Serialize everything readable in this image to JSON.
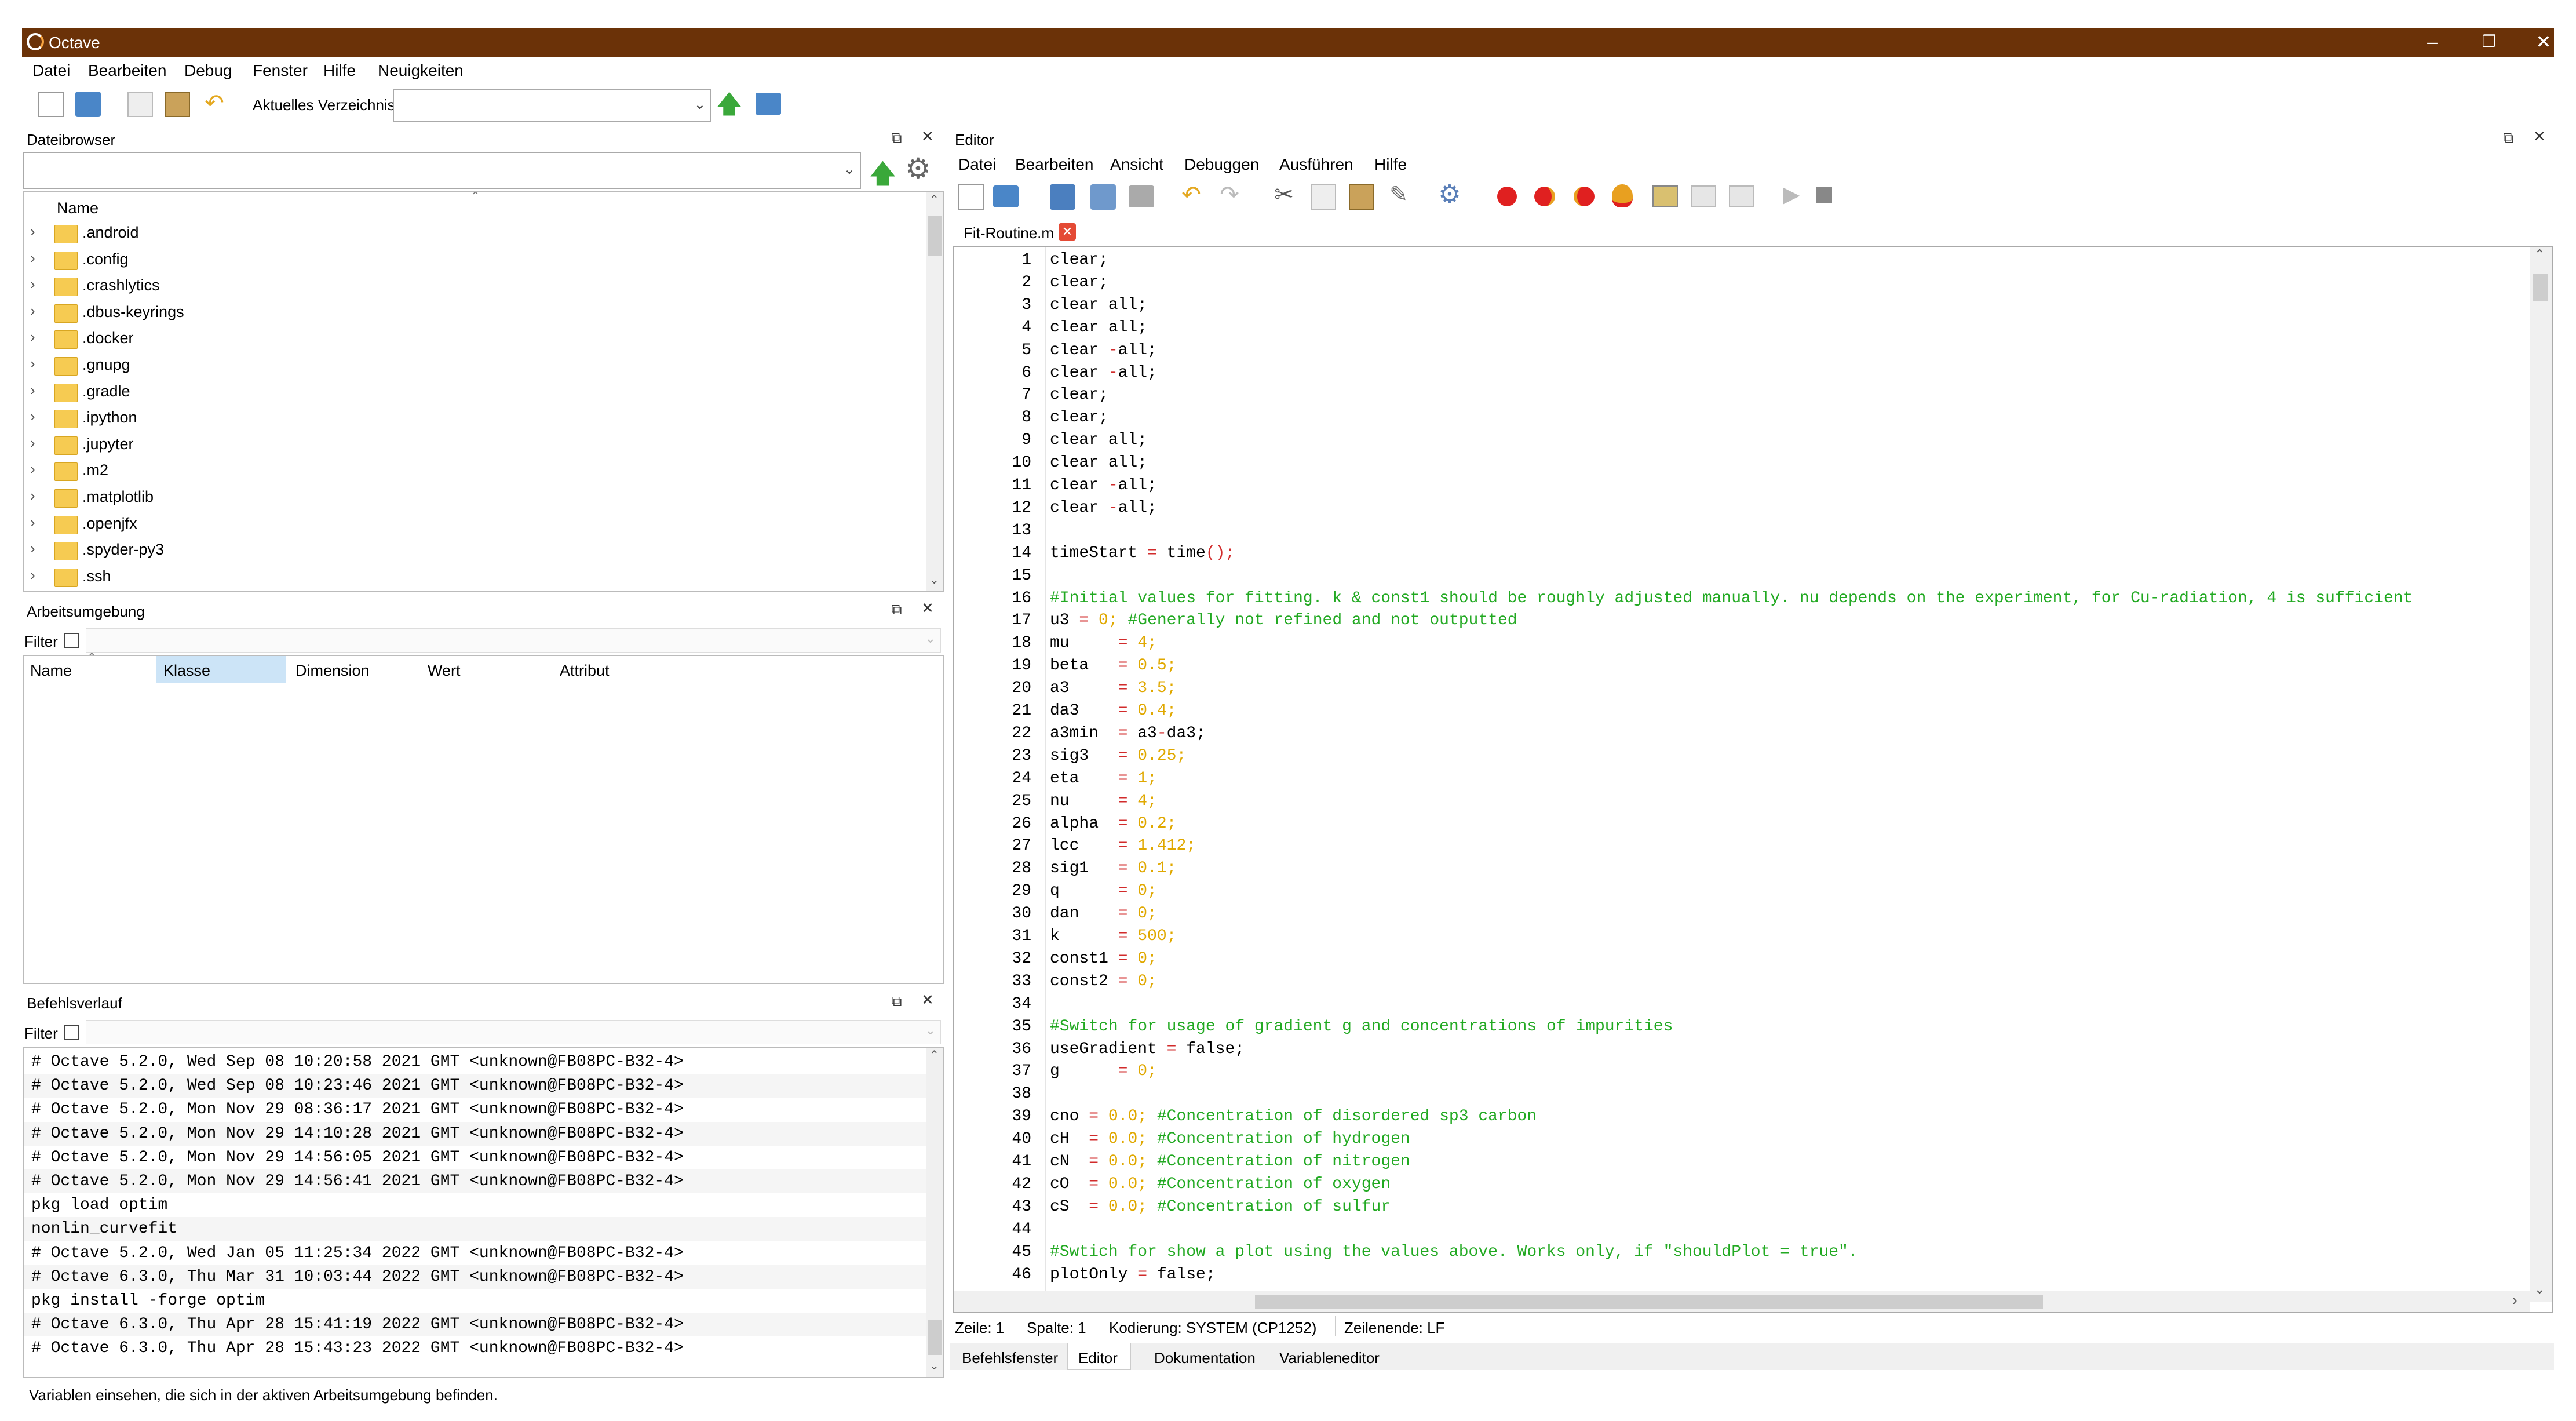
{
  "window": {
    "title": "Octave"
  },
  "main_menu": [
    "Datei",
    "Bearbeiten",
    "Debug",
    "Fenster",
    "Hilfe",
    "Neuigkeiten"
  ],
  "toolbar": {
    "current_dir_label": "Aktuelles Verzeichnis:",
    "current_dir_value": ""
  },
  "file_browser": {
    "title": "Dateibrowser",
    "column": "Name",
    "items": [
      ".android",
      ".config",
      ".crashlytics",
      ".dbus-keyrings",
      ".docker",
      ".gnupg",
      ".gradle",
      ".ipython",
      ".jupyter",
      ".m2",
      ".matplotlib",
      ".openjfx",
      ".spyder-py3",
      ".ssh"
    ]
  },
  "workspace": {
    "title": "Arbeitsumgebung",
    "filter_label": "Filter",
    "columns": [
      "Name",
      "Klasse",
      "Dimension",
      "Wert",
      "Attribut"
    ]
  },
  "history": {
    "title": "Befehlsverlauf",
    "filter_label": "Filter",
    "lines": [
      "# Octave 5.2.0, Wed Sep 08 10:20:58 2021 GMT <unknown@FB08PC-B32-4>",
      "# Octave 5.2.0, Wed Sep 08 10:23:46 2021 GMT <unknown@FB08PC-B32-4>",
      "# Octave 5.2.0, Mon Nov 29 08:36:17 2021 GMT <unknown@FB08PC-B32-4>",
      "# Octave 5.2.0, Mon Nov 29 14:10:28 2021 GMT <unknown@FB08PC-B32-4>",
      "# Octave 5.2.0, Mon Nov 29 14:56:05 2021 GMT <unknown@FB08PC-B32-4>",
      "# Octave 5.2.0, Mon Nov 29 14:56:41 2021 GMT <unknown@FB08PC-B32-4>",
      "pkg load optim",
      "nonlin_curvefit",
      "# Octave 5.2.0, Wed Jan 05 11:25:34 2022 GMT <unknown@FB08PC-B32-4>",
      "# Octave 6.3.0, Thu Mar 31 10:03:44 2022 GMT <unknown@FB08PC-B32-4>",
      "pkg install -forge optim",
      "# Octave 6.3.0, Thu Apr 28 15:41:19 2022 GMT <unknown@FB08PC-B32-4>",
      "# Octave 6.3.0, Thu Apr 28 15:43:23 2022 GMT <unknown@FB08PC-B32-4>"
    ]
  },
  "status_message": "Variablen einsehen, die sich in der aktiven Arbeitsumgebung befinden.",
  "editor": {
    "title": "Editor",
    "menu": [
      "Datei",
      "Bearbeiten",
      "Ansicht",
      "Debuggen",
      "Ausführen",
      "Hilfe"
    ],
    "file_tab": "Fit-Routine.m",
    "status": {
      "line": "Zeile: 1",
      "column": "Spalte: 1",
      "encoding": "Kodierung: SYSTEM (CP1252)",
      "eol": "Zeilenende: LF"
    },
    "colors": {
      "comment": "#22a922",
      "number": "#e0a800",
      "operator": "#d12b2b",
      "default": "#000000"
    },
    "lines": [
      [
        [
          "clear;",
          "d"
        ]
      ],
      [
        [
          "clear;",
          "d"
        ]
      ],
      [
        [
          "clear all;",
          "d"
        ]
      ],
      [
        [
          "clear all;",
          "d"
        ]
      ],
      [
        [
          "clear ",
          "d"
        ],
        [
          "-",
          "o"
        ],
        [
          "all;",
          "d"
        ]
      ],
      [
        [
          "clear ",
          "d"
        ],
        [
          "-",
          "o"
        ],
        [
          "all;",
          "d"
        ]
      ],
      [
        [
          "clear;",
          "d"
        ]
      ],
      [
        [
          "clear;",
          "d"
        ]
      ],
      [
        [
          "clear all;",
          "d"
        ]
      ],
      [
        [
          "clear all;",
          "d"
        ]
      ],
      [
        [
          "clear ",
          "d"
        ],
        [
          "-",
          "o"
        ],
        [
          "all;",
          "d"
        ]
      ],
      [
        [
          "clear ",
          "d"
        ],
        [
          "-",
          "o"
        ],
        [
          "all;",
          "d"
        ]
      ],
      [],
      [
        [
          "timeStart ",
          "d"
        ],
        [
          "=",
          "o"
        ],
        [
          " time",
          "d"
        ],
        [
          "();",
          "o"
        ],
        [
          "",
          "d"
        ]
      ],
      [],
      [
        [
          "#Initial values for fitting. k & const1 should be roughly adjusted manually. nu depends on the experiment, for Cu-radiation, 4 is sufficient",
          "c"
        ]
      ],
      [
        [
          "u3 ",
          "d"
        ],
        [
          "=",
          "o"
        ],
        [
          " 0;",
          "n"
        ],
        [
          " #Generally not refined and not outputted",
          "c"
        ]
      ],
      [
        [
          "mu     ",
          "d"
        ],
        [
          "=",
          "o"
        ],
        [
          " 4;",
          "n"
        ]
      ],
      [
        [
          "beta   ",
          "d"
        ],
        [
          "=",
          "o"
        ],
        [
          " 0.5;",
          "n"
        ]
      ],
      [
        [
          "a3     ",
          "d"
        ],
        [
          "=",
          "o"
        ],
        [
          " 3.5;",
          "n"
        ]
      ],
      [
        [
          "da3    ",
          "d"
        ],
        [
          "=",
          "o"
        ],
        [
          " 0.4;",
          "n"
        ]
      ],
      [
        [
          "a3min  ",
          "d"
        ],
        [
          "=",
          "o"
        ],
        [
          " a3",
          "d"
        ],
        [
          "-",
          "o"
        ],
        [
          "da3;",
          "d"
        ]
      ],
      [
        [
          "sig3   ",
          "d"
        ],
        [
          "=",
          "o"
        ],
        [
          " 0.25;",
          "n"
        ]
      ],
      [
        [
          "eta    ",
          "d"
        ],
        [
          "=",
          "o"
        ],
        [
          " 1;",
          "n"
        ]
      ],
      [
        [
          "nu     ",
          "d"
        ],
        [
          "=",
          "o"
        ],
        [
          " 4;",
          "n"
        ]
      ],
      [
        [
          "alpha  ",
          "d"
        ],
        [
          "=",
          "o"
        ],
        [
          " 0.2;",
          "n"
        ]
      ],
      [
        [
          "lcc    ",
          "d"
        ],
        [
          "=",
          "o"
        ],
        [
          " 1.412;",
          "n"
        ]
      ],
      [
        [
          "sig1   ",
          "d"
        ],
        [
          "=",
          "o"
        ],
        [
          " 0.1;",
          "n"
        ]
      ],
      [
        [
          "q      ",
          "d"
        ],
        [
          "=",
          "o"
        ],
        [
          " 0;",
          "n"
        ]
      ],
      [
        [
          "dan    ",
          "d"
        ],
        [
          "=",
          "o"
        ],
        [
          " 0;",
          "n"
        ]
      ],
      [
        [
          "k      ",
          "d"
        ],
        [
          "=",
          "o"
        ],
        [
          " 500;",
          "n"
        ]
      ],
      [
        [
          "const1 ",
          "d"
        ],
        [
          "=",
          "o"
        ],
        [
          " 0;",
          "n"
        ]
      ],
      [
        [
          "const2 ",
          "d"
        ],
        [
          "=",
          "o"
        ],
        [
          " 0;",
          "n"
        ]
      ],
      [],
      [
        [
          "#Switch for usage of gradient g and concentrations of impurities",
          "c"
        ]
      ],
      [
        [
          "useGradient ",
          "d"
        ],
        [
          "=",
          "o"
        ],
        [
          " false;",
          "d"
        ]
      ],
      [
        [
          "g      ",
          "d"
        ],
        [
          "=",
          "o"
        ],
        [
          " 0;",
          "n"
        ]
      ],
      [],
      [
        [
          "cno ",
          "d"
        ],
        [
          "=",
          "o"
        ],
        [
          " 0.0;",
          "n"
        ],
        [
          " #Concentration of disordered sp3 carbon",
          "c"
        ]
      ],
      [
        [
          "cH  ",
          "d"
        ],
        [
          "=",
          "o"
        ],
        [
          " 0.0;",
          "n"
        ],
        [
          " #Concentration of hydrogen",
          "c"
        ]
      ],
      [
        [
          "cN  ",
          "d"
        ],
        [
          "=",
          "o"
        ],
        [
          " 0.0;",
          "n"
        ],
        [
          " #Concentration of nitrogen",
          "c"
        ]
      ],
      [
        [
          "cO  ",
          "d"
        ],
        [
          "=",
          "o"
        ],
        [
          " 0.0;",
          "n"
        ],
        [
          " #Concentration of oxygen",
          "c"
        ]
      ],
      [
        [
          "cS  ",
          "d"
        ],
        [
          "=",
          "o"
        ],
        [
          " 0.0;",
          "n"
        ],
        [
          " #Concentration of sulfur",
          "c"
        ]
      ],
      [],
      [
        [
          "#Swtich for show a plot using the values above. Works only, if \"shouldPlot = true\".",
          "c"
        ]
      ],
      [
        [
          "plotOnly ",
          "d"
        ],
        [
          "=",
          "o"
        ],
        [
          " false;",
          "d"
        ]
      ]
    ]
  },
  "bottom_tabs": [
    "Befehlsfenster",
    "Editor",
    "Dokumentation",
    "Variableneditor"
  ]
}
